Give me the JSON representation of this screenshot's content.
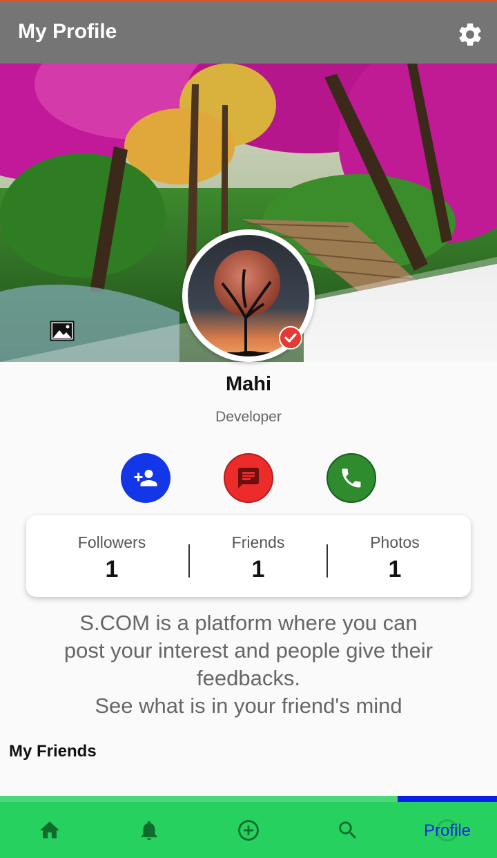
{
  "app": {
    "title": "My Profile"
  },
  "profile": {
    "name": "Mahi",
    "role": "Developer"
  },
  "actions": [
    {
      "name": "add-friend",
      "icon": "person-add-icon",
      "color": "#1236e8"
    },
    {
      "name": "message",
      "icon": "chat-icon",
      "color": "#ec2b2b"
    },
    {
      "name": "call",
      "icon": "phone-icon",
      "color": "#2e8b2e"
    }
  ],
  "stats": {
    "followers": {
      "label": "Followers",
      "value": "1"
    },
    "friends": {
      "label": "Friends",
      "value": "1"
    },
    "photos": {
      "label": "Photos",
      "value": "1"
    }
  },
  "bio": {
    "lines": [
      "S.COM is a platform where you can",
      "post your interest and people give their",
      "feedbacks.",
      "See what is in your friend's mind"
    ]
  },
  "sections": {
    "friends_title": "My Friends"
  },
  "nav": {
    "items": [
      {
        "icon": "home-icon"
      },
      {
        "icon": "bell-icon"
      },
      {
        "icon": "add-circle-icon"
      },
      {
        "icon": "search-icon"
      }
    ],
    "active_label": "Profile"
  },
  "colors": {
    "appbar": "#757575",
    "navbar": "#26d160",
    "active_tab": "#0a1ee8",
    "verified": "#e53935"
  }
}
